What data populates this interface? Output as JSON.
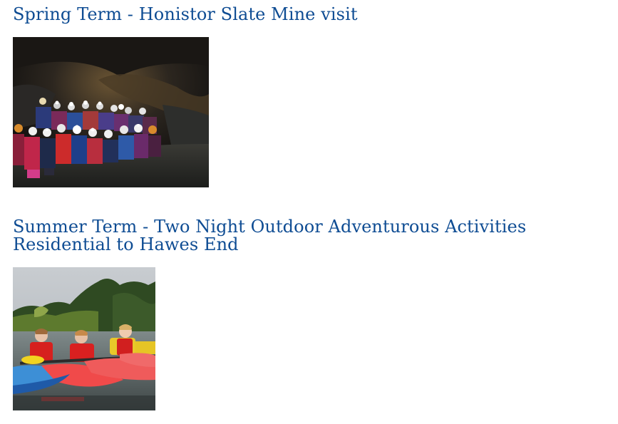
{
  "sections": [
    {
      "title": "Spring Term - Honistor Slate Mine visit",
      "image": "photo of pupils in helmets with headlamps inside a dark slate mine"
    },
    {
      "title": "Summer Term - Two Night Outdoor Adventurous Activities Residential to Hawes End",
      "image": "photo of children in red buoyancy aids sitting in kayaks on a lake"
    }
  ],
  "colors": {
    "heading": "#0e4c93",
    "background": "#ffffff"
  }
}
